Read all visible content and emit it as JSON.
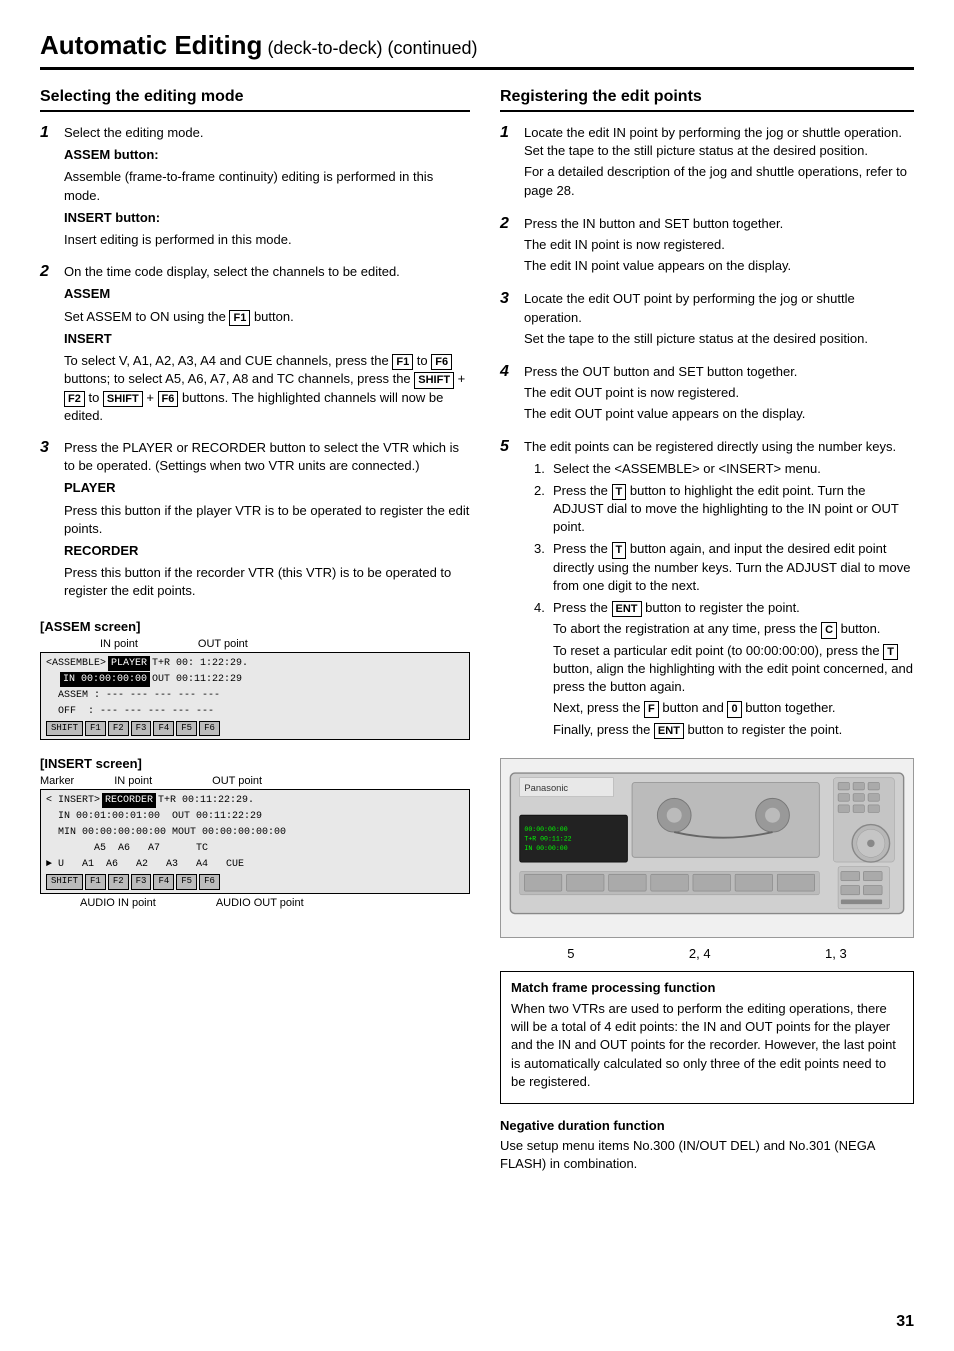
{
  "header": {
    "title": "Automatic Editing",
    "subtitle": " (deck-to-deck) (continued)"
  },
  "left_section": {
    "title": "Selecting the editing mode",
    "steps": [
      {
        "num": "1",
        "intro": "Select the editing mode.",
        "subsections": [
          {
            "label": "ASSEM button:",
            "text": "Assemble (frame-to-frame continuity) editing is performed in this mode."
          },
          {
            "label": "INSERT button:",
            "text": "Insert editing is performed in this mode."
          }
        ]
      },
      {
        "num": "2",
        "intro": "On the time code display, select the channels to be edited.",
        "subsections": [
          {
            "label": "ASSEM",
            "text": "Set ASSEM to ON using the",
            "button": "F1",
            "text2": "button."
          },
          {
            "label": "INSERT",
            "text": "To select V, A1, A2, A3, A4 and CUE channels, press the",
            "btn1": "F1",
            "text3": "to",
            "btn2": "F6",
            "text4": "buttons; to select A5, A6, A7, A8 and TC channels, press the",
            "btn3": "SHIFT",
            "text5": "+",
            "btn4": "F2",
            "text6": "to",
            "btn5": "SHIFT",
            "text7": "+",
            "btn6": "F6",
            "text8": "buttons.  The highlighted channels will now be edited."
          }
        ]
      },
      {
        "num": "3",
        "intro": "Press the PLAYER or RECORDER button to select the VTR which is to be operated. (Settings when two VTR units are connected.)",
        "subsections": [
          {
            "label": "PLAYER",
            "text": "Press this button if the player VTR is to be operated to register the edit points."
          },
          {
            "label": "RECORDER",
            "text": "Press this button if the recorder VTR (this VTR) is to be operated to register the edit points."
          }
        ]
      }
    ],
    "assem_screen": {
      "label": "[ASSEM screen]",
      "in_label": "IN point",
      "out_label": "OUT point",
      "line1": "<ASSEMBLE>  [PLAYER] T+R 00: 1:22:29.",
      "line2": "  [IN 00:00:00:00] OUT 00:11:22:29",
      "line3": "  ASSEM :  ---  ---  ---  ---  ---",
      "line4": "  OFF  :  ---  ---  ---  ---  ---",
      "buttons": [
        "SHIFT",
        "F1",
        "F2",
        "F3",
        "F4",
        "F5",
        "F6"
      ]
    },
    "insert_screen": {
      "label": "[INSERT screen]",
      "marker_label": "Marker",
      "in_label": "IN point",
      "out_label": "OUT point",
      "line1": "< INSERT>  [RECORDER] T+R 00:11:22:29.",
      "line2": "  IN 00:01:00:01:00  OUT 00:11:22:29",
      "line3": "  MIN 00:00:00:00:00 MOUT 00:00:00:00:00",
      "line4": "        A5  A6   A7      TC",
      "line5": "> U   A1  A6   A2   A3   A4   CUE",
      "buttons": [
        "SHIFT",
        "F1",
        "F2",
        "F3",
        "F4",
        "F5",
        "F6"
      ],
      "audio_in_label": "AUDIO IN point",
      "audio_out_label": "AUDIO OUT point"
    }
  },
  "right_section": {
    "title": "Registering the edit points",
    "steps": [
      {
        "num": "1",
        "text": "Locate the edit IN point by performing the jog or shuttle operation.  Set the tape to the still picture status at the desired position.",
        "text2": "For a detailed description of the jog and shuttle operations, refer to page 28."
      },
      {
        "num": "2",
        "text": "Press the IN button and SET button together.",
        "text2": "The edit IN point is now registered.",
        "text3": "The edit IN point value appears on the display."
      },
      {
        "num": "3",
        "text": "Locate the edit OUT point by performing the jog or shuttle operation.",
        "text2": "Set the tape to the still picture status at the desired position."
      },
      {
        "num": "4",
        "text": "Press the OUT button and SET button together.",
        "text2": "The edit OUT point is now registered.",
        "text3": "The edit OUT point value appears on the display."
      },
      {
        "num": "5",
        "intro": "The edit points can be registered directly using the number keys.",
        "sub_items": [
          {
            "num": "1.",
            "text": "Select the <ASSEMBLE> or <INSERT> menu."
          },
          {
            "num": "2.",
            "text": "Press the",
            "button": "T",
            "text2": "button to highlight the edit point.  Turn the ADJUST dial to move the highlighting to the IN point or OUT point."
          },
          {
            "num": "3.",
            "text": "Press the",
            "button": "T",
            "text2": "button again, and input the desired edit point directly using the number keys.  Turn the ADJUST dial to move from one digit to the next."
          },
          {
            "num": "4.",
            "text": "Press the",
            "button": "ENT",
            "text2": "button to register the point.",
            "extra": "To abort the registration at any time, press the",
            "button2": "C",
            "extra2": "button.",
            "extra3": "To reset a particular edit point (to 00:00:00:00), press the",
            "button3": "T",
            "extra4": "button, align the highlighting with the edit point concerned, and press the button again.",
            "extra5": "Next, press the",
            "button4": "F",
            "extra6": "button and",
            "button5": "0",
            "extra7": "button together.",
            "extra8": "Finally, press the",
            "button6": "ENT",
            "extra9": "button to register the point."
          }
        ]
      }
    ],
    "vtr_labels": {
      "label5": "5",
      "label24": "2, 4",
      "label13": "1, 3"
    },
    "info_box": {
      "title": "Match frame processing function",
      "text": "When two VTRs are used to perform the editing operations, there will be a total of 4 edit points: the IN and OUT points for the player and the IN and OUT points for the recorder.  However, the last point is automatically calculated so only three of the edit points need to be registered."
    },
    "neg_section": {
      "title": "Negative duration function",
      "text": "Use setup menu items No.300 (IN/OUT DEL) and No.301 (NEGA FLASH) in combination."
    }
  },
  "page_number": "31"
}
